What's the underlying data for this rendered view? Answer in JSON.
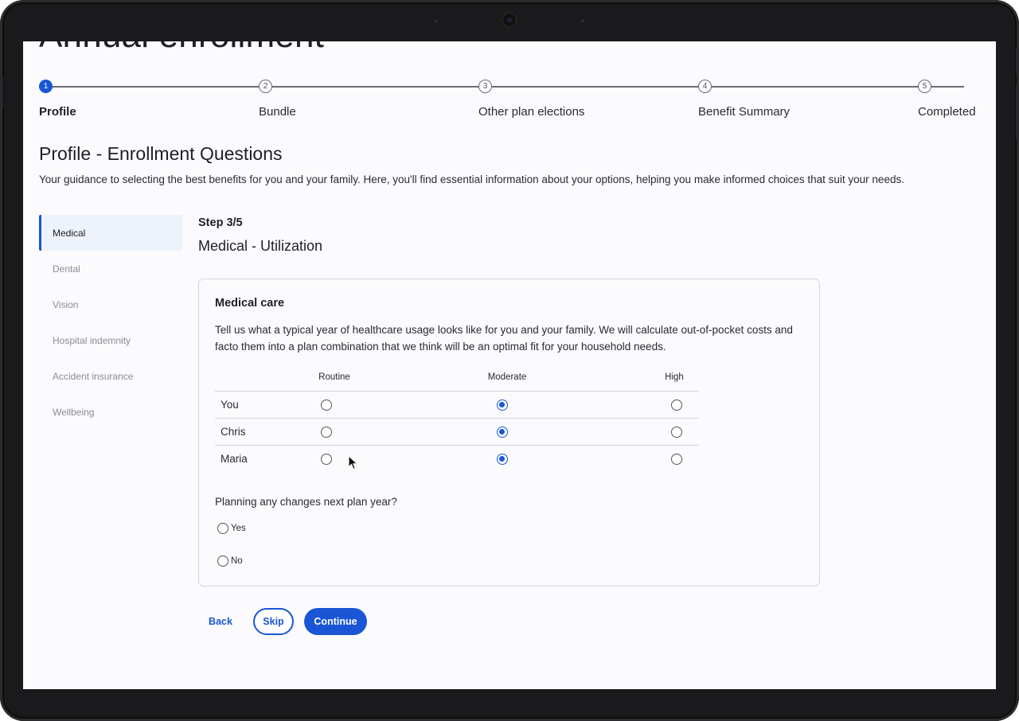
{
  "page": {
    "heading": "Annual enrollment"
  },
  "stepper": {
    "steps": [
      {
        "number": "1",
        "label": "Profile",
        "active": true
      },
      {
        "number": "2",
        "label": "Bundle",
        "active": false
      },
      {
        "number": "3",
        "label": "Other plan elections",
        "active": false
      },
      {
        "number": "4",
        "label": "Benefit Summary",
        "active": false
      },
      {
        "number": "5",
        "label": "Completed",
        "active": false
      }
    ]
  },
  "section": {
    "title": "Profile - Enrollment Questions",
    "description": "Your guidance to selecting the best benefits for you and your family. Here, you'll find essential information about your options, helping you make informed choices that suit your needs."
  },
  "sidenav": {
    "items": [
      {
        "label": "Medical",
        "active": true
      },
      {
        "label": "Dental",
        "active": false
      },
      {
        "label": "Vision",
        "active": false
      },
      {
        "label": "Hospital indemnity",
        "active": false
      },
      {
        "label": "Accident insurance",
        "active": false
      },
      {
        "label": "Wellbeing",
        "active": false
      }
    ]
  },
  "main": {
    "step_count": "Step 3/5",
    "step_title": "Medical - Utilization",
    "card": {
      "title": "Medical care",
      "description": "Tell us what a typical year of healthcare usage looks like for you and your family. We will calculate out-of-pocket costs and facto them into a plan combination that we think will be an optimal fit for your household needs.",
      "columns": [
        "Routine",
        "Moderate",
        "High"
      ],
      "rows": [
        {
          "name": "You",
          "selected": "Moderate"
        },
        {
          "name": "Chris",
          "selected": "Moderate"
        },
        {
          "name": "Maria",
          "selected": "Moderate"
        }
      ],
      "plan_question": "Planning any changes next plan year?",
      "options": [
        {
          "label": "Yes",
          "selected": false
        },
        {
          "label": "No",
          "selected": false
        }
      ]
    }
  },
  "actions": {
    "back": "Back",
    "skip": "Skip",
    "continue": "Continue"
  },
  "colors": {
    "accent": "#1a55d6",
    "border": "#d6d6dc",
    "bezel": "#1a1a1c"
  }
}
